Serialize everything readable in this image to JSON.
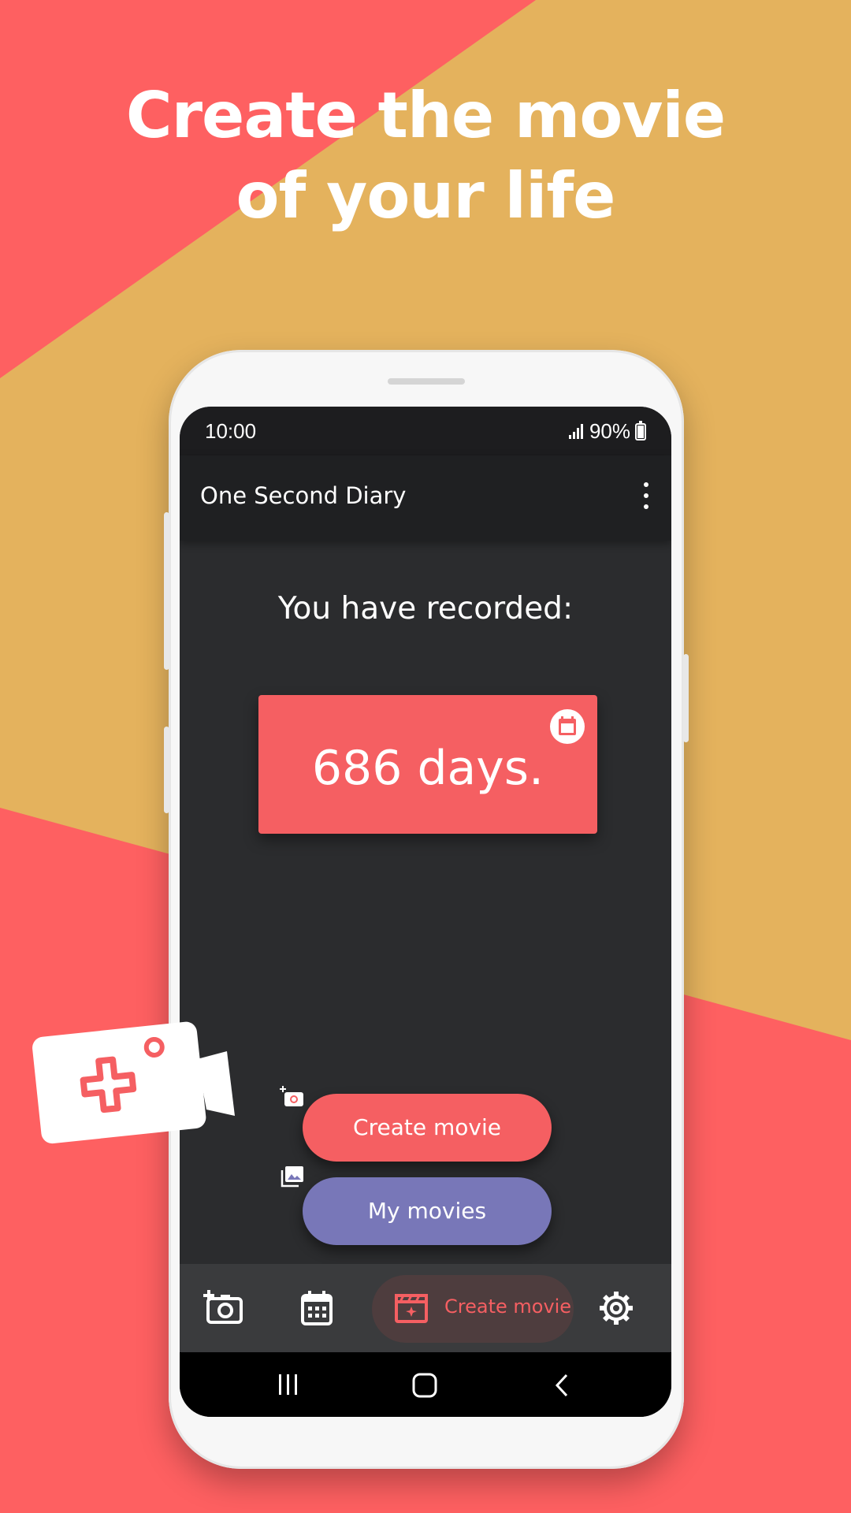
{
  "headline": {
    "line1": "Create the movie",
    "line2": "of your life"
  },
  "colors": {
    "coral": "#fe6061",
    "mustard": "#e4b25d",
    "accent": "#f55f62",
    "purple": "#7877b8",
    "screen": "#2b2c2e"
  },
  "status_bar": {
    "time": "10:00",
    "battery": "90%"
  },
  "app_bar": {
    "title": "One Second Diary",
    "menu_icon": "more-vert-icon"
  },
  "main": {
    "recorded_label": "You have recorded:",
    "days_value": "686 days.",
    "calendar_icon": "calendar-icon"
  },
  "actions": {
    "create_movie": "Create movie",
    "create_movie_icon": "add-photo-icon",
    "my_movies": "My movies",
    "my_movies_icon": "photo-library-icon"
  },
  "bottom_nav": {
    "items": [
      {
        "icon": "add-camera-icon"
      },
      {
        "icon": "calendar-icon"
      },
      {
        "icon": "movie-clapper-icon",
        "label": "Create movie",
        "active": true
      },
      {
        "icon": "settings-icon"
      }
    ]
  },
  "system_nav": {
    "recents": "recents-icon",
    "home": "home-icon",
    "back": "back-icon"
  }
}
